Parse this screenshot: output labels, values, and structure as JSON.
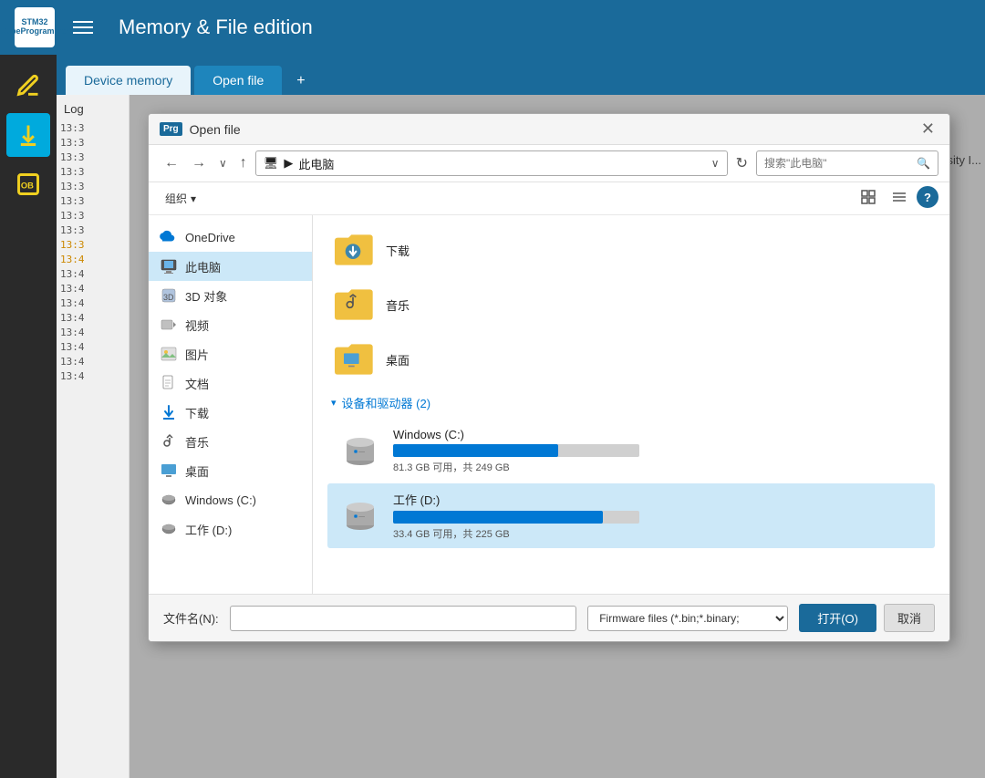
{
  "app": {
    "title": "Memory & File edition",
    "logo_line1": "STM32",
    "logo_line2": "CubeProgrammer"
  },
  "tabs": [
    {
      "label": "Device memory",
      "active": true
    },
    {
      "label": "Open file",
      "active": false
    },
    {
      "label": "+",
      "active": false
    }
  ],
  "log": {
    "label": "Log",
    "lines": [
      {
        "text": "13:3",
        "yellow": false
      },
      {
        "text": "13:3",
        "yellow": false
      },
      {
        "text": "13:3",
        "yellow": false
      },
      {
        "text": "13:3",
        "yellow": false
      },
      {
        "text": "13:3",
        "yellow": false
      },
      {
        "text": "13:3",
        "yellow": false
      },
      {
        "text": "13:3",
        "yellow": false
      },
      {
        "text": "13:3",
        "yellow": false
      },
      {
        "text": "13:3",
        "yellow": true
      },
      {
        "text": "13:4",
        "yellow": false
      },
      {
        "text": "13:4",
        "yellow": false
      },
      {
        "text": "13:4",
        "yellow": false
      },
      {
        "text": "13:4",
        "yellow": false
      },
      {
        "text": "13:4",
        "yellow": false
      },
      {
        "text": "13:4",
        "yellow": false
      },
      {
        "text": "13:4",
        "yellow": false
      },
      {
        "text": "13:4",
        "yellow": false
      },
      {
        "text": "13:4",
        "yellow": false
      }
    ]
  },
  "dialog": {
    "title": "Open file",
    "icon_label": "Prg",
    "toolbar": {
      "back": "←",
      "forward": "→",
      "dropdown": "∨",
      "up": "↑",
      "path": "此电脑",
      "path_icon": "🖥",
      "refresh": "↻",
      "search_placeholder": "搜索\"此电脑\""
    },
    "organize": {
      "label": "组织",
      "dropdown": "▾"
    },
    "nav_items": [
      {
        "label": "OneDrive",
        "icon": "cloud",
        "selected": false
      },
      {
        "label": "此电脑",
        "icon": "computer",
        "selected": true
      },
      {
        "label": "3D 对象",
        "icon": "3d",
        "selected": false
      },
      {
        "label": "视频",
        "icon": "video",
        "selected": false
      },
      {
        "label": "图片",
        "icon": "image",
        "selected": false
      },
      {
        "label": "文档",
        "icon": "document",
        "selected": false
      },
      {
        "label": "下载",
        "icon": "download",
        "selected": false
      },
      {
        "label": "音乐",
        "icon": "music",
        "selected": false
      },
      {
        "label": "桌面",
        "icon": "desktop",
        "selected": false
      },
      {
        "label": "Windows (C:)",
        "icon": "drive_c",
        "selected": false
      },
      {
        "label": "工作 (D:)",
        "icon": "drive_d",
        "selected": false
      }
    ],
    "folders": [
      {
        "name": "音乐",
        "type": "music_folder"
      },
      {
        "name": "桌面",
        "type": "desktop_folder"
      }
    ],
    "section_label": "设备和驱动器 (2)",
    "drives": [
      {
        "name": "Windows (C:)",
        "free": "81.3 GB 可用，共 249 GB",
        "fill_percent": 67,
        "icon": "drive"
      },
      {
        "name": "工作 (D:)",
        "free": "33.4 GB 可用，共 225 GB",
        "fill_percent": 85,
        "icon": "drive",
        "selected": true
      }
    ],
    "footer": {
      "filename_label": "文件名(N):",
      "filetype_label": "Firmware files (*.bin;*.binary;",
      "open_label": "打开(O)",
      "cancel_label": "取消"
    }
  },
  "colors": {
    "accent": "#1a6a9a",
    "tab_active": "#e8f4fb",
    "drive_bar": "#0078d4"
  }
}
